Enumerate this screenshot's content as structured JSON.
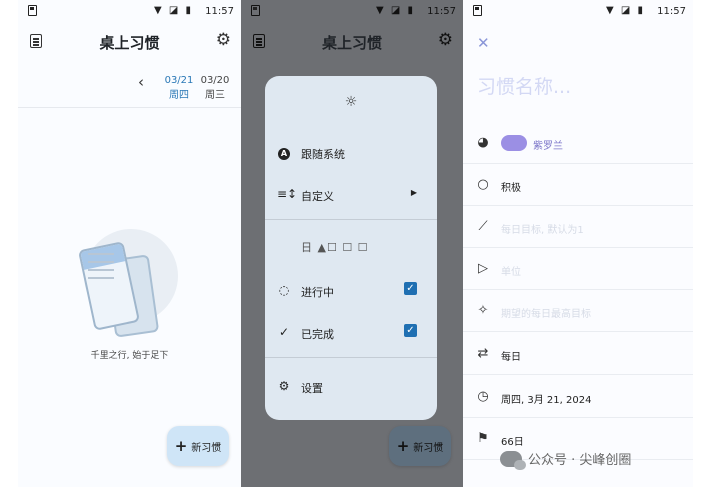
{
  "status": {
    "time": "11:57",
    "icons": "▼ ◪ ▮"
  },
  "app": {
    "title": "桌上习惯"
  },
  "dates": [
    {
      "date": "03/21",
      "weekday": "周四",
      "active": true
    },
    {
      "date": "03/20",
      "weekday": "周三",
      "active": false
    }
  ],
  "empty_state": {
    "text": "千里之行, 始于足下"
  },
  "fab": {
    "label": "新习惯"
  },
  "theme_menu": {
    "items": [
      {
        "icon": "A",
        "label": "跟随系统"
      },
      {
        "icon": "≡↕",
        "label": "自定义"
      }
    ],
    "glitched_row": "日 ▲☐ ☐ ☐",
    "filters": [
      {
        "label": "进行中",
        "checked": true
      },
      {
        "label": "已完成",
        "checked": true
      }
    ],
    "settings_label": "设置"
  },
  "editor": {
    "name_placeholder": "习惯名称...",
    "color_label": "紫罗兰",
    "color_hex": "#9b8fe4",
    "type_label": "积极",
    "daily_target_placeholder": "每日目标, 默认为1",
    "unit_placeholder": "单位",
    "max_target_placeholder": "期望的每日最高目标",
    "frequency_label": "每日",
    "start_date_label": "周四, 3月 21, 2024",
    "duration_label": "66日"
  },
  "watermark": {
    "text": "公众号 · 尖峰创圈"
  }
}
